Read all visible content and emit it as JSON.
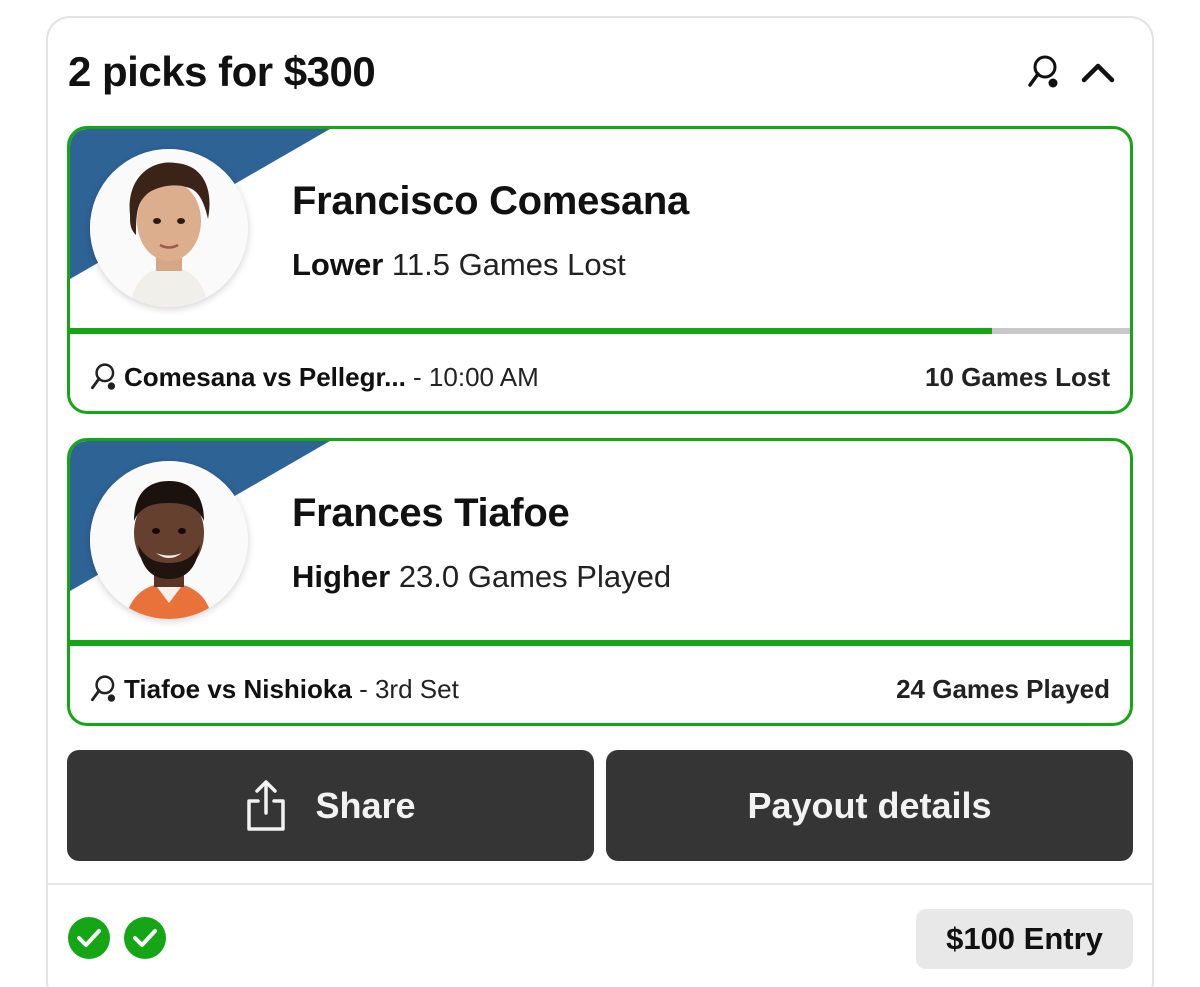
{
  "header": {
    "title": "2 picks for $300",
    "sport_icon": "tennis-icon",
    "collapse_icon": "chevron-up-icon"
  },
  "picks": [
    {
      "player": "Francisco Comesana",
      "direction": "Lower",
      "line": "11.5 Games Lost",
      "progress": 0.87,
      "match": "Comesana vs Pellegr...",
      "status": "- 10:00 AM",
      "stat": "10 Games Lost",
      "avatar_icon": "player-photo"
    },
    {
      "player": "Frances Tiafoe",
      "direction": "Higher",
      "line": "23.0 Games Played",
      "progress": 1.0,
      "match": "Tiafoe vs Nishioka",
      "status": "- 3rd Set",
      "stat": "24 Games Played",
      "avatar_icon": "player-photo"
    }
  ],
  "actions": {
    "share_label": "Share",
    "payout_label": "Payout details"
  },
  "footer": {
    "checks": [
      "check-icon",
      "check-icon"
    ],
    "entry_label": "$100 Entry"
  },
  "colors": {
    "accent_green": "#14a614",
    "stripe_blue": "#2e6396",
    "button_dark": "#353535",
    "progress_track": "#c8c8c8"
  }
}
